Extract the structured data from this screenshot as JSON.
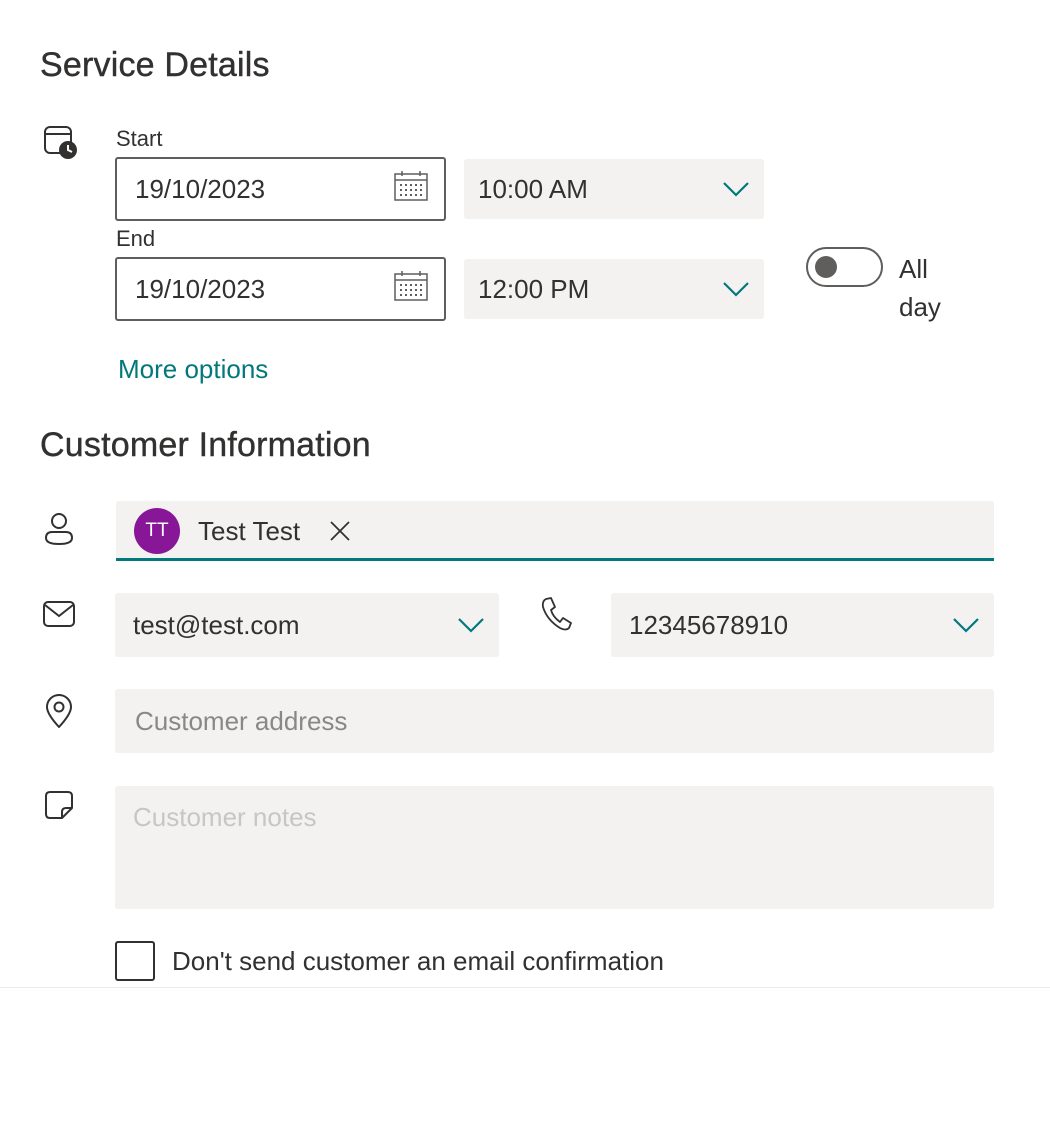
{
  "service_details": {
    "title": "Service Details",
    "start_label": "Start",
    "start_date": "19/10/2023",
    "start_time": "10:00 AM",
    "end_label": "End",
    "end_date": "19/10/2023",
    "end_time": "12:00 PM",
    "all_day_label_line1": "All",
    "all_day_label_line2": "day",
    "all_day_on": false,
    "more_options": "More options"
  },
  "customer_information": {
    "title": "Customer Information",
    "customer": {
      "initials": "TT",
      "name": "Test Test",
      "avatar_color": "#881798"
    },
    "email": "test@test.com",
    "phone": "12345678910",
    "address_placeholder": "Customer address",
    "notes_placeholder": "Customer notes",
    "no_confirmation_label": "Don't send customer an email confirmation",
    "no_confirmation_checked": false
  },
  "colors": {
    "accent": "#03787c",
    "field_bg": "#f3f2f1"
  }
}
